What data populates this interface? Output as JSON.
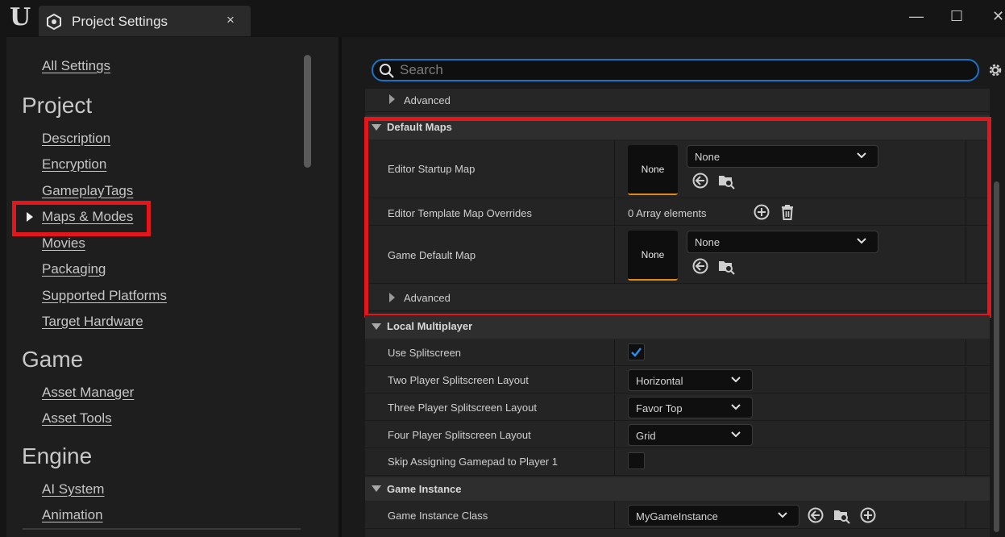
{
  "window": {
    "logo": "U",
    "tab_title": "Project Settings",
    "tab_close": "×",
    "minimize": "—",
    "maximize": "☐",
    "close": "✕"
  },
  "nav": {
    "all_settings": "All Settings",
    "sections": [
      {
        "title": "Project",
        "items": [
          "Description",
          "Encryption",
          "GameplayTags",
          "Maps & Modes",
          "Movies",
          "Packaging",
          "Supported Platforms",
          "Target Hardware"
        ]
      },
      {
        "title": "Game",
        "items": [
          "Asset Manager",
          "Asset Tools"
        ]
      },
      {
        "title": "Engine",
        "items": [
          "AI System",
          "Animation"
        ]
      }
    ],
    "selected": "Maps & Modes"
  },
  "search": {
    "placeholder": "Search"
  },
  "details": {
    "advanced_label": "Advanced",
    "default_maps": {
      "title": "Default Maps",
      "editor_startup_map": {
        "label": "Editor Startup Map",
        "thumb": "None",
        "value": "None"
      },
      "editor_template_overrides": {
        "label": "Editor Template Map Overrides",
        "value": "0 Array elements"
      },
      "game_default_map": {
        "label": "Game Default Map",
        "thumb": "None",
        "value": "None"
      },
      "advanced": "Advanced"
    },
    "local_multiplayer": {
      "title": "Local Multiplayer",
      "use_splitscreen": {
        "label": "Use Splitscreen",
        "checked": true
      },
      "two_player": {
        "label": "Two Player Splitscreen Layout",
        "value": "Horizontal"
      },
      "three_player": {
        "label": "Three Player Splitscreen Layout",
        "value": "Favor Top"
      },
      "four_player": {
        "label": "Four Player Splitscreen Layout",
        "value": "Grid"
      },
      "skip_gamepad": {
        "label": "Skip Assigning Gamepad to Player 1",
        "checked": false
      }
    },
    "game_instance": {
      "title": "Game Instance",
      "class": {
        "label": "Game Instance Class",
        "value": "MyGameInstance"
      }
    }
  },
  "colors": {
    "highlight": "#e3161b",
    "accent": "#1a73c6",
    "thumb_underline": "#e08a1e"
  },
  "icons": [
    "search-icon",
    "gear-icon",
    "browse-back-icon",
    "folder-search-icon",
    "add-icon",
    "trash-icon",
    "chevron-down-icon",
    "checkmark-icon"
  ]
}
